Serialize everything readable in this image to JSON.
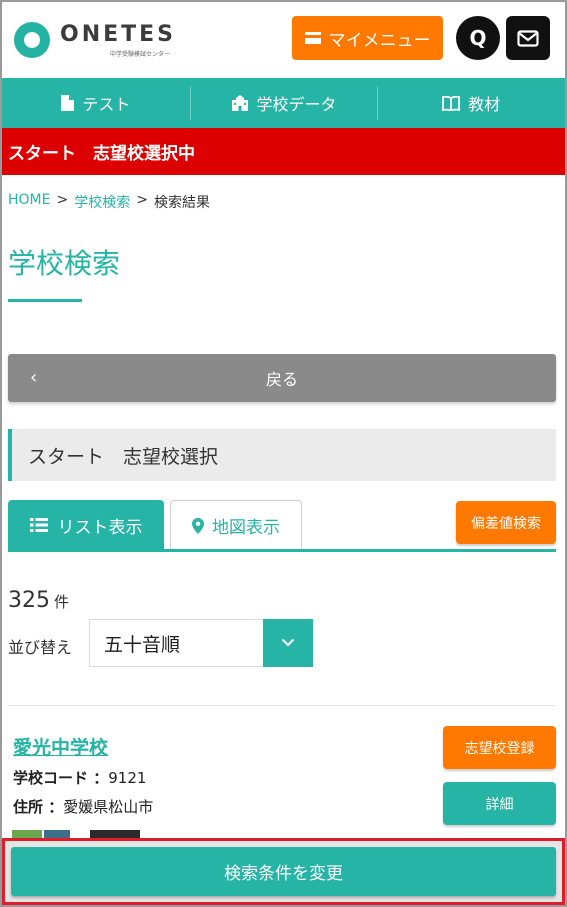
{
  "header": {
    "logo_text": "ONETES",
    "logo_sub": "中学受験模試センター",
    "mymenu_label": "マイメニュー",
    "q_label": "Q"
  },
  "nav": {
    "items": [
      {
        "label": "テスト",
        "icon": "document-icon"
      },
      {
        "label": "学校データ",
        "icon": "school-icon"
      },
      {
        "label": "教材",
        "icon": "book-icon"
      }
    ]
  },
  "banner": {
    "text": "スタート　志望校選択中"
  },
  "breadcrumb": {
    "home": "HOME",
    "sep": ">",
    "search": "学校検索",
    "current": "検索結果"
  },
  "page": {
    "title": "学校検索"
  },
  "back": {
    "label": "戻る",
    "chevron": "‹"
  },
  "section": {
    "title": "スタート　志望校選択"
  },
  "tabs": {
    "list": "リスト表示",
    "map": "地図表示",
    "hensachi": "偏差値検索"
  },
  "results": {
    "count": "325",
    "unit": "件"
  },
  "sort": {
    "label": "並び替え",
    "value": "五十音順"
  },
  "school": {
    "name": "愛光中学校",
    "code_label": "学校コード ：",
    "code": "9121",
    "address_label": "住所 ：",
    "address": "愛媛県松山市",
    "register_button": "志望校登録",
    "detail_button": "詳細"
  },
  "footer": {
    "button": "検索条件を変更"
  },
  "colors": {
    "teal": "#25b4a5",
    "orange": "#ff7800",
    "red": "#dd0000",
    "gray": "#8a8a8a"
  }
}
